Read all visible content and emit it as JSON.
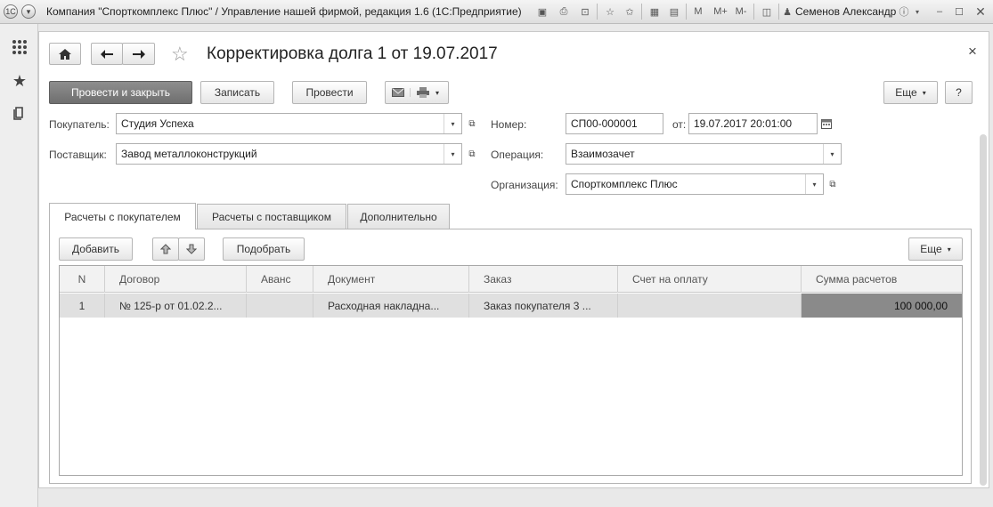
{
  "app": {
    "title": "Компания \"Спорткомплекс Плюс\" / Управление нашей фирмой, редакция 1.6  (1С:Предприятие)",
    "toolbar_m": "M",
    "toolbar_mplus": "M+",
    "toolbar_mminus": "M-",
    "user": "Семенов Александр"
  },
  "form": {
    "title": "Корректировка долга 1 от 19.07.2017",
    "close": "×",
    "buttons": {
      "post_close": "Провести и закрыть",
      "save": "Записать",
      "post": "Провести",
      "more": "Еще",
      "help": "?"
    },
    "fields": {
      "buyer_label": "Покупатель:",
      "buyer_value": "Студия Успеха",
      "supplier_label": "Поставщик:",
      "supplier_value": "Завод металлоконструкций",
      "number_label": "Номер:",
      "number_value": "СП00-000001",
      "date_label": "от:",
      "date_value": "19.07.2017 20:01:00",
      "operation_label": "Операция:",
      "operation_value": "Взаимозачет",
      "org_label": "Организация:",
      "org_value": "Спорткомплекс Плюс"
    },
    "tabs": [
      {
        "label": "Расчеты с покупателем"
      },
      {
        "label": "Расчеты с поставщиком"
      },
      {
        "label": "Дополнительно"
      }
    ],
    "table_toolbar": {
      "add": "Добавить",
      "pick": "Подобрать",
      "more": "Еще"
    },
    "table": {
      "columns": [
        "N",
        "Договор",
        "Аванс",
        "Документ",
        "Заказ",
        "Счет на оплату",
        "Сумма расчетов"
      ],
      "rows": [
        [
          "1",
          "№ 125-р от 01.02.2...",
          "",
          "Расходная накладна...",
          "Заказ покупателя 3 ...",
          "",
          "100 000,00"
        ]
      ]
    }
  }
}
